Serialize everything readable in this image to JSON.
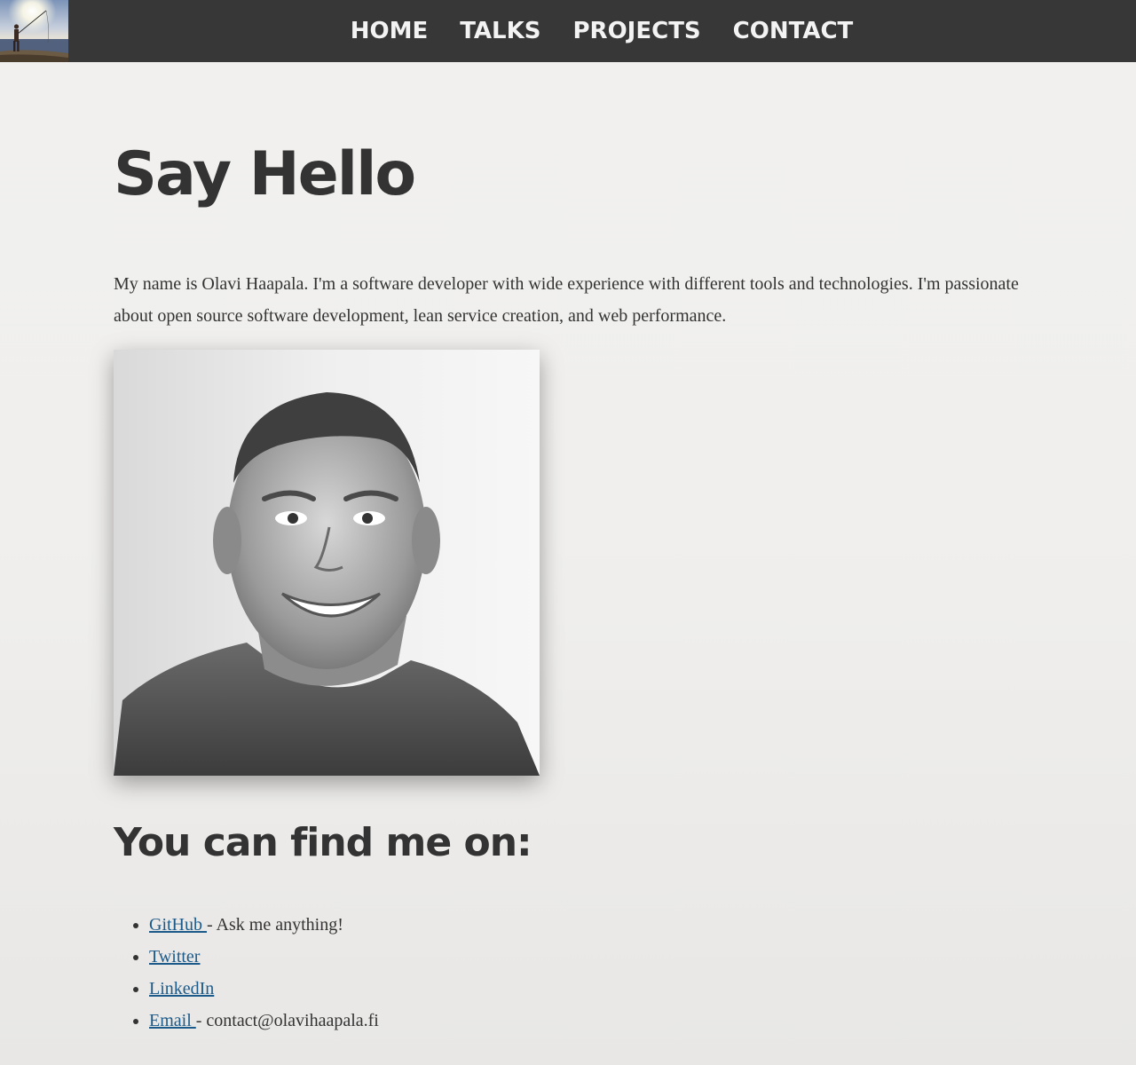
{
  "nav": {
    "logo_alt": "fisherman-at-sunset-logo",
    "items": [
      {
        "label": "HOME"
      },
      {
        "label": "TALKS"
      },
      {
        "label": "PROJECTS"
      },
      {
        "label": "CONTACT"
      }
    ]
  },
  "main": {
    "title": "Say Hello",
    "intro": "My name is Olavi Haapala. I'm a software developer with wide experience with different tools and technologies. I'm passionate about open source software development, lean service creation, and web performance.",
    "portrait_icon": "portrait-photo",
    "find_heading": "You can find me on:",
    "links": [
      {
        "label": "GitHub ",
        "suffix": "- Ask me anything!"
      },
      {
        "label": "Twitter",
        "suffix": ""
      },
      {
        "label": "LinkedIn",
        "suffix": ""
      },
      {
        "label": "Email ",
        "suffix": "- contact@olavihaapala.fi"
      }
    ]
  },
  "colors": {
    "topbar": "#373737",
    "nav_text": "#f3f3f3",
    "heading": "#333333",
    "link": "#1c5a8a",
    "background": "#f0efed"
  }
}
